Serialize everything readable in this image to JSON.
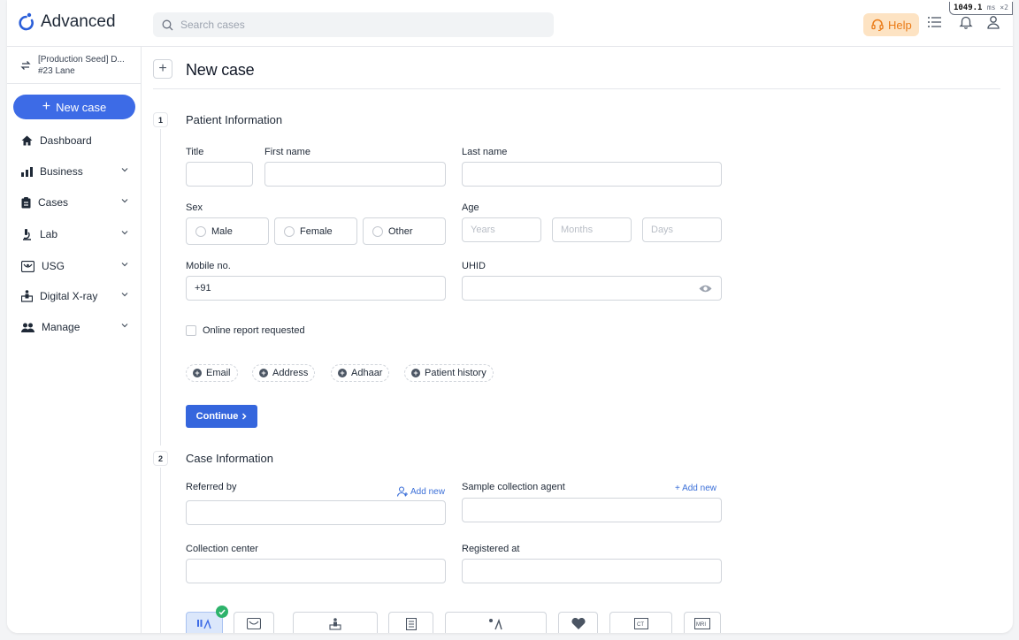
{
  "app": {
    "name": "Advanced"
  },
  "header": {
    "search_placeholder": "Search cases",
    "help_label": "Help",
    "timing_value": "1049.1",
    "timing_unit": "ms ×2"
  },
  "sidebar": {
    "org_line1": "[Production Seed] D...",
    "org_line2": "#23 Lane",
    "new_case_label": "New case",
    "items": [
      {
        "label": "Dashboard",
        "icon": "home-icon"
      },
      {
        "label": "Business",
        "icon": "bar-chart-icon"
      },
      {
        "label": "Cases",
        "icon": "clipboard-icon"
      },
      {
        "label": "Lab",
        "icon": "microscope-icon"
      },
      {
        "label": "USG",
        "icon": "ultrasound-icon"
      },
      {
        "label": "Digital X-ray",
        "icon": "xray-machine-icon"
      },
      {
        "label": "Manage",
        "icon": "users-icon"
      }
    ]
  },
  "page": {
    "title": "New case"
  },
  "patient": {
    "step": "1",
    "title": "Patient Information",
    "title_label": "Title",
    "first_name_label": "First name",
    "last_name_label": "Last name",
    "sex_label": "Sex",
    "sex_options": [
      "Male",
      "Female",
      "Other"
    ],
    "age_label": "Age",
    "age_placeholders": [
      "Years",
      "Months",
      "Days"
    ],
    "mobile_label": "Mobile no.",
    "mobile_value": "+91",
    "uhid_label": "UHID",
    "online_report_label": "Online report requested",
    "chips": [
      "Email",
      "Address",
      "Adhaar",
      "Patient history"
    ],
    "continue_label": "Continue"
  },
  "case": {
    "step": "2",
    "title": "Case Information",
    "referred_by_label": "Referred by",
    "referred_add_new": "Add new",
    "agent_label": "Sample collection agent",
    "agent_add_new": "+ Add new",
    "collection_center_label": "Collection center",
    "registered_at_label": "Registered at"
  },
  "colors": {
    "accent": "#3d6be6",
    "help_bg": "#fde3c3",
    "help_text": "#ea7b17",
    "success": "#2db36b"
  }
}
